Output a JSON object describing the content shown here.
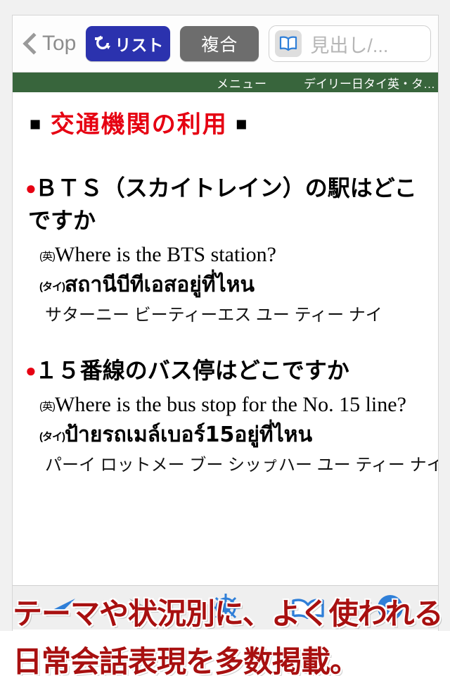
{
  "navbar": {
    "back_label": "Top",
    "back_icon": "chevron-left-icon",
    "list_button": {
      "label": "リスト",
      "icon": "loop-arrow-icon",
      "color": "#2b32ae"
    },
    "compound_button": {
      "label": "複合",
      "color": "#6d6d6d"
    },
    "search": {
      "placeholder": "見出し/...",
      "value": "",
      "icon": "open-book-icon"
    }
  },
  "menubar": {
    "menu_label": "メニュー",
    "dictionary_title": "デイリー日タイ英・タ…",
    "color": "#38653c"
  },
  "content": {
    "section_title": "交通機関の利用",
    "square_mark": "■",
    "accent_color": "#e60012",
    "entries": [
      {
        "bullet": "●",
        "headword": "ＢＴＳ（スカイトレイン）の駅はどこですか",
        "english_tag": "(英)",
        "english": "Where is the BTS station?",
        "thai_tag": "(タイ)",
        "thai": "สถานีบีทีเอสอยู่ที่ไหน",
        "kana": "サターニー ビーティーエス ユー ティー ナイ"
      },
      {
        "bullet": "●",
        "headword": "１５番線のバス停はどこですか",
        "english_tag": "(英)",
        "english": "Where is the bus stop for the No. 15 line?",
        "thai_tag": "(タイ)",
        "thai": "ป้ายรถเมล์เบอร์15อยู่ที่ไหน",
        "kana": "パーイ ロットメー ブー シッㇷ゚ハー ユー ティー ナイ"
      }
    ]
  },
  "toolbar": {
    "items": [
      {
        "name": "back-arrow-icon",
        "color": "#2f7fd8"
      },
      {
        "name": "forward-arrow-icon",
        "color": "#a9a9a9"
      },
      {
        "name": "ship-wheel-icon",
        "color": "#2f7fd8"
      },
      {
        "name": "book-icon",
        "color": "#2f7fd8"
      },
      {
        "name": "help-question-icon",
        "color": "#2f7fd8"
      }
    ]
  },
  "promo": {
    "line1": "テーマや状況別に、よく使われる",
    "line2": "日常会話表現を多数掲載。",
    "color": "#a81010"
  }
}
